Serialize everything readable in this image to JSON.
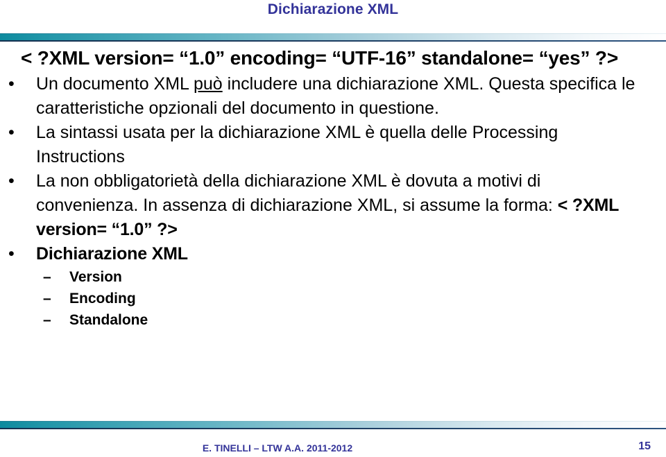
{
  "slide": {
    "title": "Dichiarazione XML",
    "title_color": "#333399",
    "accent_color": "#0d8a9e",
    "rule_line_color": "#15304f",
    "page_background": "#ffffff"
  },
  "content": {
    "code_line": "< ?XML version= “1.0” encoding= “UTF-16” standalone= “yes” ?>",
    "bullet_marker": "•",
    "dash_marker": "–",
    "bullets": [
      {
        "id": "bullet-documento-xml",
        "runs": [
          {
            "text": "Un documento XML ",
            "style": "normal"
          },
          {
            "text": "può",
            "style": "underline"
          },
          {
            "text": " includere una dichiarazione XML. Questa specifica le caratteristiche opzionali del documento in questione.",
            "style": "normal"
          }
        ],
        "plain": "Un documento XML può includere una dichiarazione XML. Questa specifica le caratteristiche opzionali del documento in questione."
      },
      {
        "id": "bullet-sintassi",
        "runs": [
          {
            "text": "La sintassi usata per la dichiarazione XML è quella delle Processing Instructions",
            "style": "normal"
          }
        ],
        "plain": "La sintassi usata per la dichiarazione XML è quella delle Processing Instructions"
      },
      {
        "id": "bullet-obbligatorieta",
        "runs": [
          {
            "text": "La non obbligatorietà della dichiarazione XML è dovuta a motivi di convenienza. In assenza di dichiarazione XML, si assume la forma: ",
            "style": "normal"
          },
          {
            "text": "< ?XML version= “1.0” ?>",
            "style": "bold"
          }
        ],
        "plain": "La non obbligatorietà della dichiarazione XML è dovuta a motivi di convenienza. In assenza di dichiarazione XML, si assume la forma: < ?XML version= “1.0” ?>"
      },
      {
        "id": "bullet-dichiarazione-xml",
        "runs": [
          {
            "text": "Dichiarazione XML",
            "style": "bold"
          }
        ],
        "plain": "Dichiarazione XML"
      }
    ],
    "sub_bullets": [
      {
        "id": "sub-version",
        "label": "Version"
      },
      {
        "id": "sub-encoding",
        "label": "Encoding"
      },
      {
        "id": "sub-standalone",
        "label": "Standalone"
      }
    ]
  },
  "footer": {
    "author_line": "E. TINELLI – LTW  A.A. 2011-2012",
    "page_number": "15"
  }
}
